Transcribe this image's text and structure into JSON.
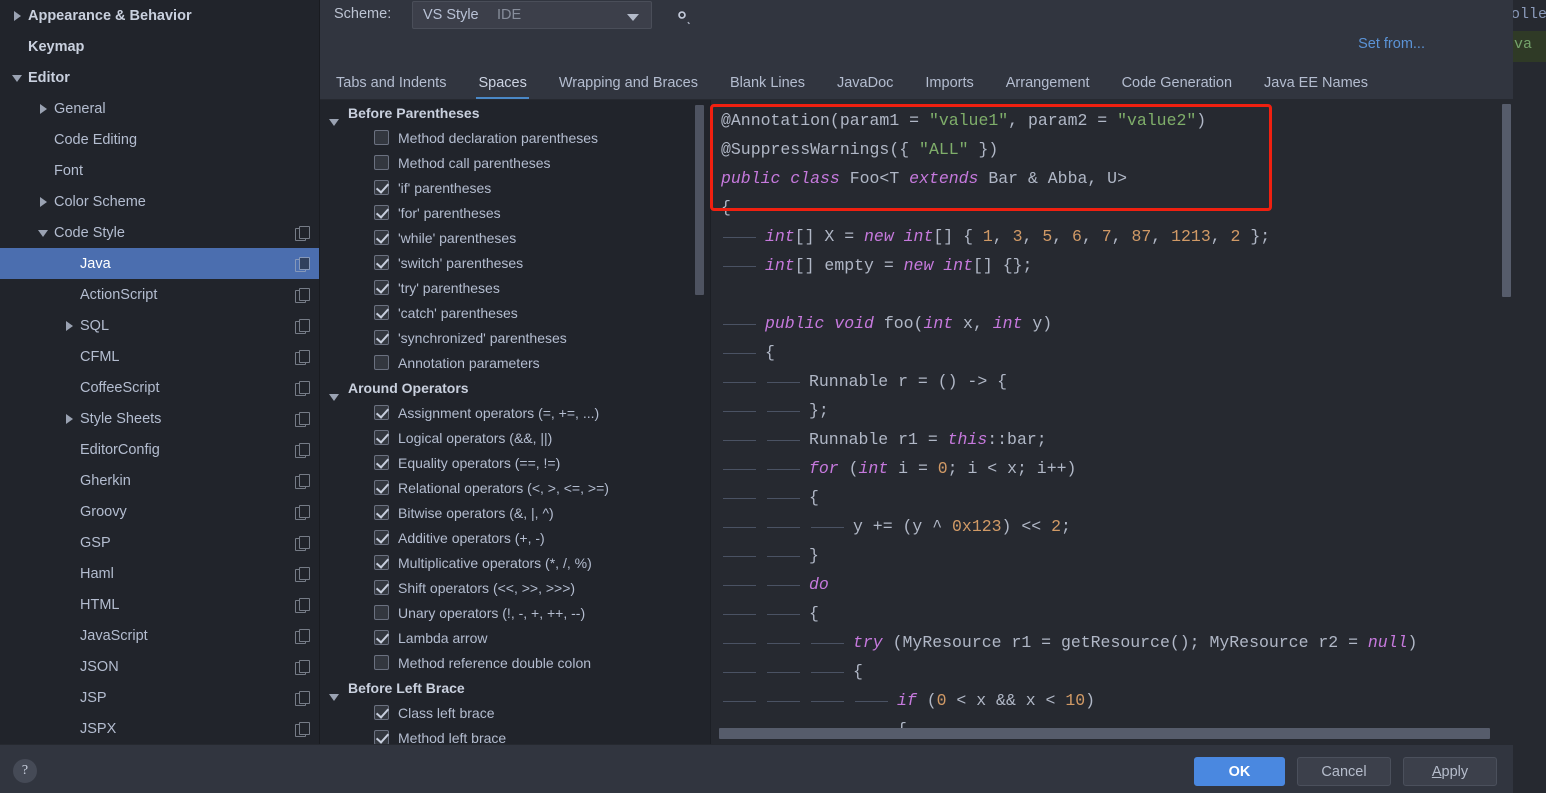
{
  "background_app": {
    "right_text": "roller",
    "green_text": "va"
  },
  "scheme_bar": {
    "label": "Scheme:",
    "value": "VS Style",
    "sub_value": "IDE",
    "dropdown_icon": "chevron-down-icon",
    "gear_icon": "gear-icon",
    "set_from_link": "Set from..."
  },
  "sidebar": {
    "items": [
      {
        "label": "Appearance & Behavior",
        "twisty": "right",
        "indent": 0,
        "bold": true,
        "copy": false,
        "selected": false
      },
      {
        "label": "Keymap",
        "twisty": "none",
        "indent": 0,
        "bold": true,
        "copy": false,
        "selected": false
      },
      {
        "label": "Editor",
        "twisty": "down",
        "indent": 0,
        "bold": true,
        "copy": false,
        "selected": false
      },
      {
        "label": "General",
        "twisty": "right",
        "indent": 1,
        "bold": false,
        "copy": false,
        "selected": false
      },
      {
        "label": "Code Editing",
        "twisty": "none",
        "indent": 1,
        "bold": false,
        "copy": false,
        "selected": false
      },
      {
        "label": "Font",
        "twisty": "none",
        "indent": 1,
        "bold": false,
        "copy": false,
        "selected": false
      },
      {
        "label": "Color Scheme",
        "twisty": "right",
        "indent": 1,
        "bold": false,
        "copy": false,
        "selected": false
      },
      {
        "label": "Code Style",
        "twisty": "down",
        "indent": 1,
        "bold": false,
        "copy": true,
        "selected": false
      },
      {
        "label": "Java",
        "twisty": "none",
        "indent": 2,
        "bold": false,
        "copy": true,
        "selected": true
      },
      {
        "label": "ActionScript",
        "twisty": "none",
        "indent": 2,
        "bold": false,
        "copy": true,
        "selected": false
      },
      {
        "label": "SQL",
        "twisty": "right",
        "indent": 2,
        "bold": false,
        "copy": true,
        "selected": false
      },
      {
        "label": "CFML",
        "twisty": "none",
        "indent": 2,
        "bold": false,
        "copy": true,
        "selected": false
      },
      {
        "label": "CoffeeScript",
        "twisty": "none",
        "indent": 2,
        "bold": false,
        "copy": true,
        "selected": false
      },
      {
        "label": "Style Sheets",
        "twisty": "right",
        "indent": 2,
        "bold": false,
        "copy": true,
        "selected": false
      },
      {
        "label": "EditorConfig",
        "twisty": "none",
        "indent": 2,
        "bold": false,
        "copy": true,
        "selected": false
      },
      {
        "label": "Gherkin",
        "twisty": "none",
        "indent": 2,
        "bold": false,
        "copy": true,
        "selected": false
      },
      {
        "label": "Groovy",
        "twisty": "none",
        "indent": 2,
        "bold": false,
        "copy": true,
        "selected": false
      },
      {
        "label": "GSP",
        "twisty": "none",
        "indent": 2,
        "bold": false,
        "copy": true,
        "selected": false
      },
      {
        "label": "Haml",
        "twisty": "none",
        "indent": 2,
        "bold": false,
        "copy": true,
        "selected": false
      },
      {
        "label": "HTML",
        "twisty": "none",
        "indent": 2,
        "bold": false,
        "copy": true,
        "selected": false
      },
      {
        "label": "JavaScript",
        "twisty": "none",
        "indent": 2,
        "bold": false,
        "copy": true,
        "selected": false
      },
      {
        "label": "JSON",
        "twisty": "none",
        "indent": 2,
        "bold": false,
        "copy": true,
        "selected": false
      },
      {
        "label": "JSP",
        "twisty": "none",
        "indent": 2,
        "bold": false,
        "copy": true,
        "selected": false
      },
      {
        "label": "JSPX",
        "twisty": "none",
        "indent": 2,
        "bold": false,
        "copy": true,
        "selected": false
      }
    ]
  },
  "tabs": [
    {
      "label": "Tabs and Indents",
      "active": false
    },
    {
      "label": "Spaces",
      "active": true
    },
    {
      "label": "Wrapping and Braces",
      "active": false
    },
    {
      "label": "Blank Lines",
      "active": false
    },
    {
      "label": "JavaDoc",
      "active": false
    },
    {
      "label": "Imports",
      "active": false
    },
    {
      "label": "Arrangement",
      "active": false
    },
    {
      "label": "Code Generation",
      "active": false
    },
    {
      "label": "Java EE Names",
      "active": false
    }
  ],
  "options": [
    {
      "type": "group",
      "label": "Before Parentheses"
    },
    {
      "type": "checkbox",
      "label": "Method declaration parentheses",
      "checked": false
    },
    {
      "type": "checkbox",
      "label": "Method call parentheses",
      "checked": false
    },
    {
      "type": "checkbox",
      "label": "'if' parentheses",
      "checked": true
    },
    {
      "type": "checkbox",
      "label": "'for' parentheses",
      "checked": true
    },
    {
      "type": "checkbox",
      "label": "'while' parentheses",
      "checked": true
    },
    {
      "type": "checkbox",
      "label": "'switch' parentheses",
      "checked": true
    },
    {
      "type": "checkbox",
      "label": "'try' parentheses",
      "checked": true
    },
    {
      "type": "checkbox",
      "label": "'catch' parentheses",
      "checked": true
    },
    {
      "type": "checkbox",
      "label": "'synchronized' parentheses",
      "checked": true
    },
    {
      "type": "checkbox",
      "label": "Annotation parameters",
      "checked": false
    },
    {
      "type": "group",
      "label": "Around Operators"
    },
    {
      "type": "checkbox",
      "label": "Assignment operators (=, +=, ...)",
      "checked": true
    },
    {
      "type": "checkbox",
      "label": "Logical operators (&&, ||)",
      "checked": true
    },
    {
      "type": "checkbox",
      "label": "Equality operators (==, !=)",
      "checked": true
    },
    {
      "type": "checkbox",
      "label": "Relational operators (<, >, <=, >=)",
      "checked": true
    },
    {
      "type": "checkbox",
      "label": "Bitwise operators (&, |, ^)",
      "checked": true
    },
    {
      "type": "checkbox",
      "label": "Additive operators (+, -)",
      "checked": true
    },
    {
      "type": "checkbox",
      "label": "Multiplicative operators (*, /, %)",
      "checked": true
    },
    {
      "type": "checkbox",
      "label": "Shift operators (<<, >>, >>>)",
      "checked": true
    },
    {
      "type": "checkbox",
      "label": "Unary operators (!, -, +, ++, --)",
      "checked": false
    },
    {
      "type": "checkbox",
      "label": "Lambda arrow",
      "checked": true
    },
    {
      "type": "checkbox",
      "label": "Method reference double colon",
      "checked": false
    },
    {
      "type": "group",
      "label": "Before Left Brace"
    },
    {
      "type": "checkbox",
      "label": "Class left brace",
      "checked": true
    },
    {
      "type": "checkbox",
      "label": "Method left brace",
      "checked": true
    }
  ],
  "code_preview": {
    "highlight_color": "#f02010",
    "lines": [
      {
        "guides": 0,
        "tokens": [
          {
            "t": "@Annotation(param1 = ",
            "c": "plain"
          },
          {
            "t": "\"value1\"",
            "c": "str"
          },
          {
            "t": ", param2 = ",
            "c": "plain"
          },
          {
            "t": "\"value2\"",
            "c": "str"
          },
          {
            "t": ")",
            "c": "plain"
          }
        ]
      },
      {
        "guides": 0,
        "tokens": [
          {
            "t": "@SuppressWarnings({ ",
            "c": "plain"
          },
          {
            "t": "\"ALL\"",
            "c": "str"
          },
          {
            "t": " })",
            "c": "plain"
          }
        ]
      },
      {
        "guides": 0,
        "tokens": [
          {
            "t": "public class",
            "c": "kw"
          },
          {
            "t": " Foo<T ",
            "c": "plain"
          },
          {
            "t": "extends",
            "c": "kw"
          },
          {
            "t": " Bar & Abba, U>",
            "c": "plain"
          }
        ]
      },
      {
        "guides": 0,
        "tokens": [
          {
            "t": "{",
            "c": "plain"
          }
        ]
      },
      {
        "guides": 1,
        "tokens": [
          {
            "t": "int",
            "c": "kw"
          },
          {
            "t": "[] X = ",
            "c": "plain"
          },
          {
            "t": "new",
            "c": "kw"
          },
          {
            "t": " ",
            "c": "plain"
          },
          {
            "t": "int",
            "c": "kw"
          },
          {
            "t": "[] { ",
            "c": "plain"
          },
          {
            "t": "1",
            "c": "num"
          },
          {
            "t": ", ",
            "c": "plain"
          },
          {
            "t": "3",
            "c": "num"
          },
          {
            "t": ", ",
            "c": "plain"
          },
          {
            "t": "5",
            "c": "num"
          },
          {
            "t": ", ",
            "c": "plain"
          },
          {
            "t": "6",
            "c": "num"
          },
          {
            "t": ", ",
            "c": "plain"
          },
          {
            "t": "7",
            "c": "num"
          },
          {
            "t": ", ",
            "c": "plain"
          },
          {
            "t": "87",
            "c": "num"
          },
          {
            "t": ", ",
            "c": "plain"
          },
          {
            "t": "1213",
            "c": "num"
          },
          {
            "t": ", ",
            "c": "plain"
          },
          {
            "t": "2",
            "c": "num"
          },
          {
            "t": " };",
            "c": "plain"
          }
        ]
      },
      {
        "guides": 1,
        "tokens": [
          {
            "t": "int",
            "c": "kw"
          },
          {
            "t": "[] empty = ",
            "c": "plain"
          },
          {
            "t": "new",
            "c": "kw"
          },
          {
            "t": " ",
            "c": "plain"
          },
          {
            "t": "int",
            "c": "kw"
          },
          {
            "t": "[] {};",
            "c": "plain"
          }
        ]
      },
      {
        "guides": 0,
        "tokens": [
          {
            "t": "",
            "c": "plain"
          }
        ]
      },
      {
        "guides": 1,
        "tokens": [
          {
            "t": "public void",
            "c": "kw"
          },
          {
            "t": " foo(",
            "c": "plain"
          },
          {
            "t": "int",
            "c": "kw"
          },
          {
            "t": " x, ",
            "c": "plain"
          },
          {
            "t": "int",
            "c": "kw"
          },
          {
            "t": " y)",
            "c": "plain"
          }
        ]
      },
      {
        "guides": 1,
        "tokens": [
          {
            "t": "{",
            "c": "plain"
          }
        ]
      },
      {
        "guides": 2,
        "tokens": [
          {
            "t": "Runnable r = () -> {",
            "c": "plain"
          }
        ]
      },
      {
        "guides": 2,
        "tokens": [
          {
            "t": "};",
            "c": "plain"
          }
        ]
      },
      {
        "guides": 2,
        "tokens": [
          {
            "t": "Runnable r1 = ",
            "c": "plain"
          },
          {
            "t": "this",
            "c": "kw"
          },
          {
            "t": "::bar;",
            "c": "plain"
          }
        ]
      },
      {
        "guides": 2,
        "tokens": [
          {
            "t": "for",
            "c": "kw"
          },
          {
            "t": " (",
            "c": "plain"
          },
          {
            "t": "int",
            "c": "kw"
          },
          {
            "t": " i = ",
            "c": "plain"
          },
          {
            "t": "0",
            "c": "num"
          },
          {
            "t": "; i < x; i++)",
            "c": "plain"
          }
        ]
      },
      {
        "guides": 2,
        "tokens": [
          {
            "t": "{",
            "c": "plain"
          }
        ]
      },
      {
        "guides": 3,
        "tokens": [
          {
            "t": "y += (y ^ ",
            "c": "plain"
          },
          {
            "t": "0x123",
            "c": "num"
          },
          {
            "t": ") << ",
            "c": "plain"
          },
          {
            "t": "2",
            "c": "num"
          },
          {
            "t": ";",
            "c": "plain"
          }
        ]
      },
      {
        "guides": 2,
        "tokens": [
          {
            "t": "}",
            "c": "plain"
          }
        ]
      },
      {
        "guides": 2,
        "tokens": [
          {
            "t": "do",
            "c": "kw"
          }
        ]
      },
      {
        "guides": 2,
        "tokens": [
          {
            "t": "{",
            "c": "plain"
          }
        ]
      },
      {
        "guides": 3,
        "tokens": [
          {
            "t": "try",
            "c": "kw"
          },
          {
            "t": " (MyResource r1 = getResource(); MyResource r2 = ",
            "c": "plain"
          },
          {
            "t": "null",
            "c": "kw"
          },
          {
            "t": ")",
            "c": "plain"
          }
        ]
      },
      {
        "guides": 3,
        "tokens": [
          {
            "t": "{",
            "c": "plain"
          }
        ]
      },
      {
        "guides": 4,
        "tokens": [
          {
            "t": "if",
            "c": "kw"
          },
          {
            "t": " (",
            "c": "plain"
          },
          {
            "t": "0",
            "c": "num"
          },
          {
            "t": " < x && x < ",
            "c": "plain"
          },
          {
            "t": "10",
            "c": "num"
          },
          {
            "t": ")",
            "c": "plain"
          }
        ]
      },
      {
        "guides": 4,
        "tokens": [
          {
            "t": "{",
            "c": "plain"
          }
        ]
      }
    ]
  },
  "footer": {
    "help_icon": "question-mark-icon",
    "ok_label": "OK",
    "cancel_label": "Cancel",
    "apply_label": "Apply",
    "apply_mnemonic": "A"
  }
}
